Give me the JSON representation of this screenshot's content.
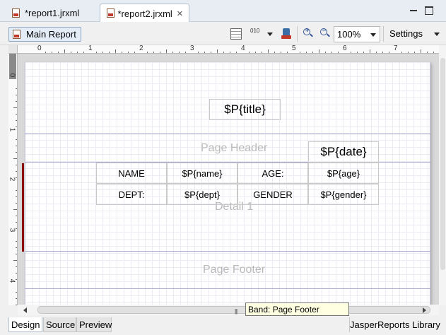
{
  "tabs": [
    {
      "label": "*report1.jrxml",
      "active": false
    },
    {
      "label": "*report2.jrxml",
      "active": true
    }
  ],
  "tab_close_glyph": "✕",
  "toolbar": {
    "main_report_label": "Main Report",
    "zoom_value": "100%",
    "settings_label": "Settings",
    "num_icon_text": "010"
  },
  "rulers": {
    "top_numbers": [
      "0",
      "1",
      "2",
      "3",
      "4",
      "5",
      "6",
      "7"
    ],
    "left_numbers": [
      "0",
      "1",
      "2",
      "3",
      "4"
    ]
  },
  "bands": {
    "page_header": "Page Header",
    "detail": "Detail 1",
    "page_footer": "Page Footer"
  },
  "fields": {
    "title": "$P{title}",
    "date": "$P{date}",
    "name_label": "NAME",
    "name_value": "$P{name}",
    "age_label": "AGE:",
    "age_value": "$P{age}",
    "dept_label": "DEPT:",
    "dept_value": "$P{dept}",
    "gender_label": "GENDER",
    "gender_value": "$P{gender}"
  },
  "tooltip": "Band: Page Footer",
  "bottom_tabs": {
    "design": "Design",
    "source": "Source",
    "preview": "Preview"
  },
  "library_label": "JasperReports Library",
  "scroll_grip": "|||"
}
